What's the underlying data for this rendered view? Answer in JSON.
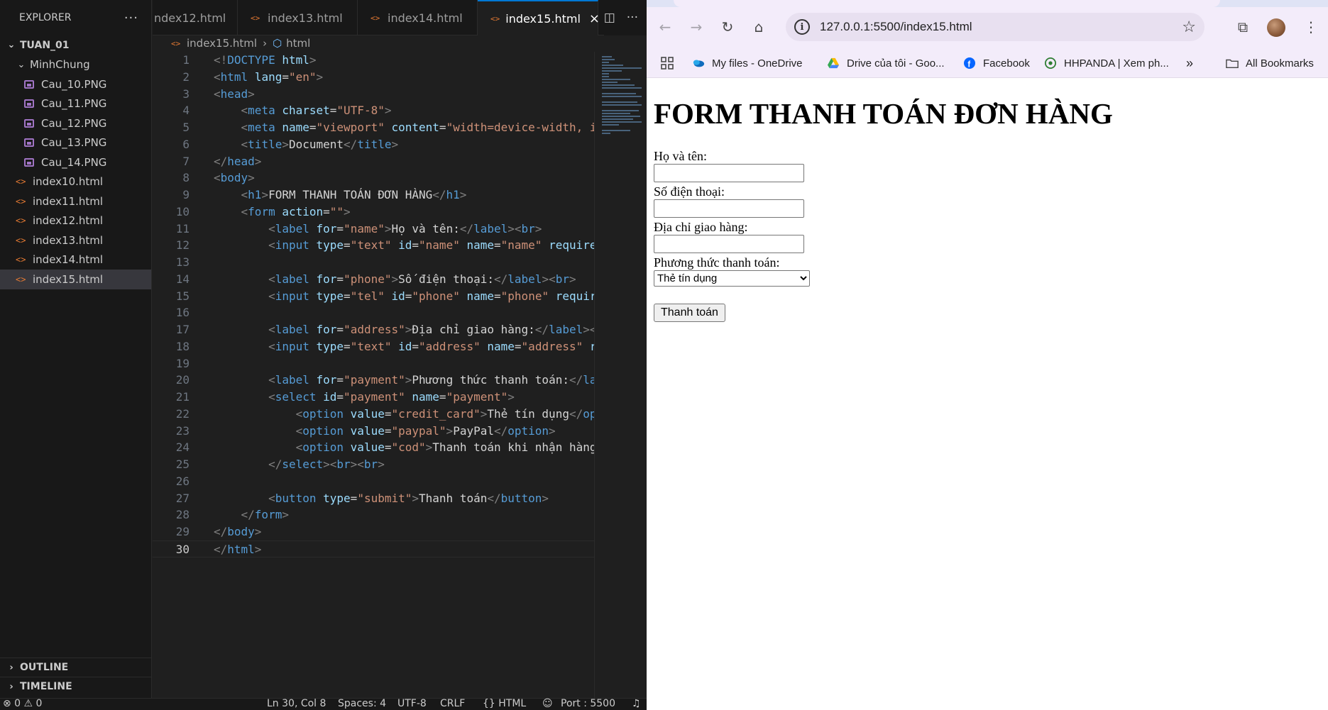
{
  "explorer": {
    "title": "EXPLORER",
    "more": "···",
    "root": "TUAN_01",
    "folder": "MinhChung",
    "images": [
      "Cau_10.PNG",
      "Cau_11.PNG",
      "Cau_12.PNG",
      "Cau_13.PNG",
      "Cau_14.PNG"
    ],
    "files": [
      "index10.html",
      "index11.html",
      "index12.html",
      "index13.html",
      "index14.html",
      "index15.html"
    ],
    "active_file": "index15.html",
    "outline": "OUTLINE",
    "timeline": "TIMELINE"
  },
  "tabs": [
    "ndex12.html",
    "index13.html",
    "index14.html",
    "index15.html"
  ],
  "active_tab": "index15.html",
  "breadcrumb": {
    "file": "index15.html",
    "symbol": "html"
  },
  "code_lines": [
    "1",
    "2",
    "3",
    "4",
    "5",
    "6",
    "7",
    "8",
    "9",
    "10",
    "11",
    "12",
    "13",
    "14",
    "15",
    "16",
    "17",
    "18",
    "19",
    "20",
    "21",
    "22",
    "23",
    "24",
    "25",
    "26",
    "27",
    "28",
    "29",
    "30"
  ],
  "code_text": {
    "doctype": "DOCTYPE",
    "doc_title": "Document",
    "h1": "FORM THANH TOÁN ĐƠN HÀNG",
    "lbl_name": "Họ và tên:",
    "lbl_phone": "Số điện thoại:",
    "lbl_address": "Địa chỉ giao hàng:",
    "lbl_payment": "Phương thức thanh toán:",
    "opt_credit": "Thẻ tín dụng",
    "opt_paypal": "PayPal",
    "opt_cod": "Thanh toán khi nhận hàng",
    "btn": "Thanh toán"
  },
  "statusbar": {
    "problems": "⊗ 0 ⚠ 0",
    "position": "Ln 30, Col 8",
    "spaces": "Spaces: 4",
    "encoding": "UTF-8",
    "eol": "CRLF",
    "language": "{} HTML",
    "port": "Port : 5500"
  },
  "browser": {
    "url": "127.0.0.1:5500/index15.html",
    "bookmarks": [
      "My files - OneDrive",
      "Drive của tôi - Goo...",
      "Facebook",
      "HHPANDA | Xem ph...",
      "All Bookmarks"
    ],
    "more_bookmarks": "»"
  },
  "page": {
    "heading": "FORM THANH TOÁN ĐƠN HÀNG",
    "name_label": "Họ và tên:",
    "phone_label": "Số điện thoại:",
    "address_label": "Địa chỉ giao hàng:",
    "payment_label": "Phương thức thanh toán:",
    "payment_selected": "Thẻ tín dụng",
    "submit": "Thanh toán"
  },
  "colors": {
    "editor_bg": "#1f1f1f",
    "sidebar_bg": "#181818",
    "accent": "#0078d4",
    "browser_toolbar": "#f3ecfa"
  }
}
